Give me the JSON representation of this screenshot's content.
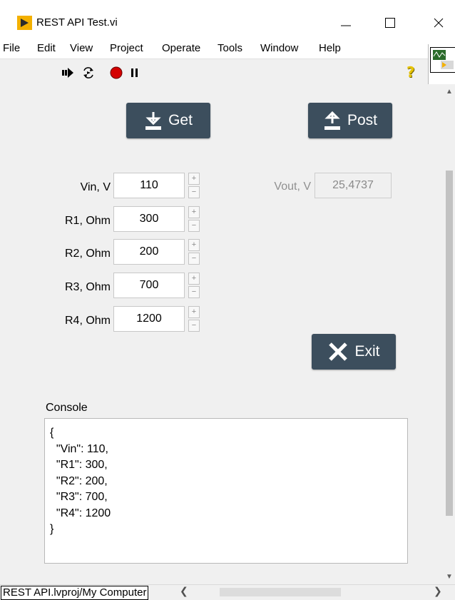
{
  "window": {
    "title": "REST API Test.vi"
  },
  "menu": [
    "File",
    "Edit",
    "View",
    "Project",
    "Operate",
    "Tools",
    "Window",
    "Help"
  ],
  "toolbar": {
    "run": "run-arrow-icon",
    "run_continuously": "run-continuously-icon",
    "abort": "abort-icon",
    "pause": "pause-icon",
    "help": "?"
  },
  "buttons": {
    "get": "Get",
    "post": "Post",
    "exit": "Exit"
  },
  "inputs": [
    {
      "label": "Vin, V",
      "value": "110"
    },
    {
      "label": "R1, Ohm",
      "value": "300"
    },
    {
      "label": "R2, Ohm",
      "value": "200"
    },
    {
      "label": "R3, Ohm",
      "value": "700"
    },
    {
      "label": "R4, Ohm",
      "value": "1200"
    }
  ],
  "stepper": {
    "up": "+",
    "down": "−"
  },
  "output": {
    "label": "Vout, V",
    "value": "25,4737"
  },
  "console": {
    "label": "Console",
    "text": "{\n  \"Vin\": 110,\n  \"R1\": 300,\n  \"R2\": 200,\n  \"R3\": 700,\n  \"R4\": 1200\n}"
  },
  "status": {
    "path": "REST API.lvproj/My Computer"
  },
  "colors": {
    "button_bg": "#3c4e5d",
    "abort": "#d40000",
    "logo": "#f3b000",
    "help": "#e8c400"
  }
}
